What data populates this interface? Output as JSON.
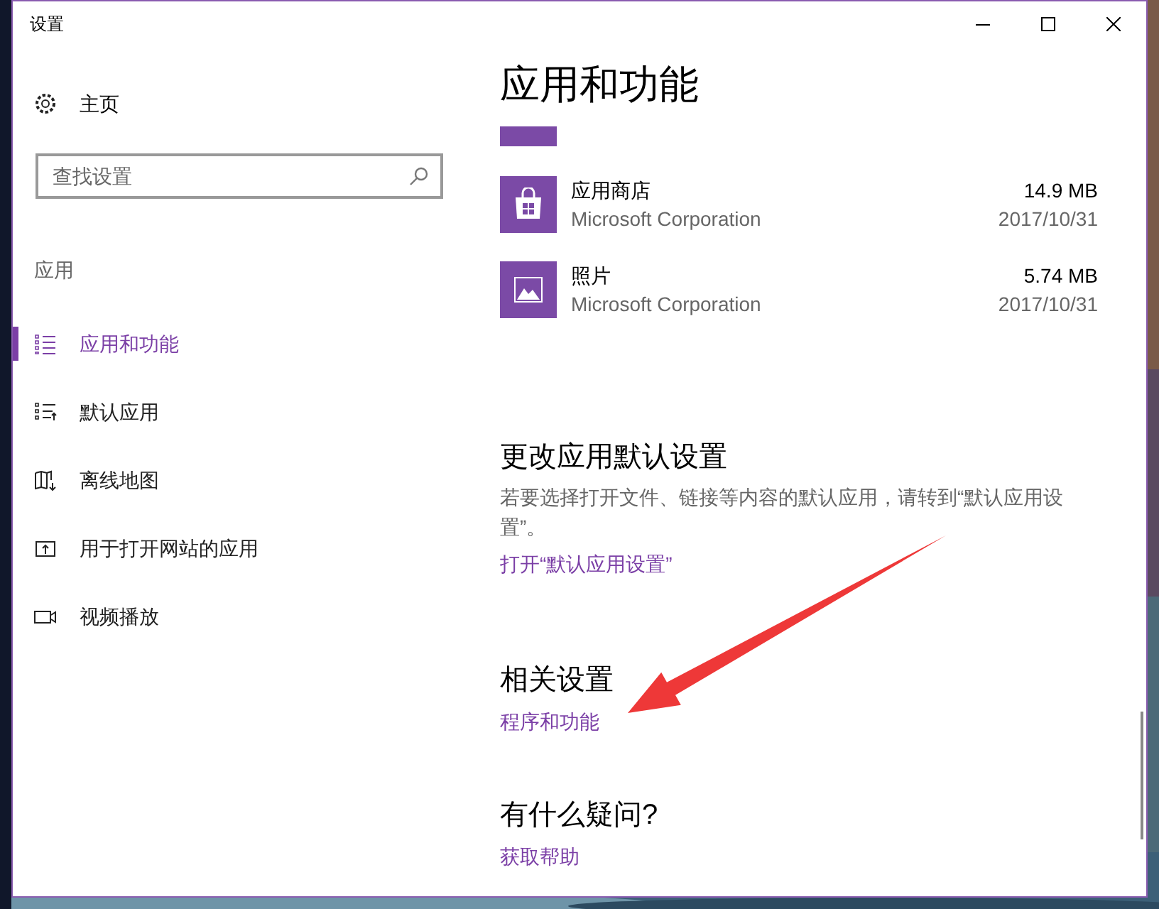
{
  "window": {
    "title": "设置"
  },
  "sidebar": {
    "home": "主页",
    "search": {
      "placeholder": "查找设置"
    },
    "section": "应用",
    "items": [
      {
        "label": "应用和功能",
        "kind": "list",
        "selected": true
      },
      {
        "label": "默认应用",
        "kind": "default",
        "selected": false
      },
      {
        "label": "离线地图",
        "kind": "map",
        "selected": false
      },
      {
        "label": "用于打开网站的应用",
        "kind": "web",
        "selected": false
      },
      {
        "label": "视频播放",
        "kind": "video",
        "selected": false
      }
    ]
  },
  "page": {
    "title": "应用和功能",
    "apps": [
      {
        "kind": "store",
        "name": "应用商店",
        "size": "14.9 MB",
        "publisher": "Microsoft Corporation",
        "date": "2017/10/31"
      },
      {
        "kind": "photos",
        "name": "照片",
        "size": "5.74 MB",
        "publisher": "Microsoft Corporation",
        "date": "2017/10/31"
      }
    ],
    "sections": [
      {
        "heading": "更改应用默认设置",
        "text": "若要选择打开文件、链接等内容的默认应用，请转到“默认应用设置”。",
        "link": "打开“默认应用设置”"
      },
      {
        "heading": "相关设置",
        "link": "程序和功能"
      },
      {
        "heading": "有什么疑问?",
        "link": "获取帮助"
      }
    ]
  }
}
